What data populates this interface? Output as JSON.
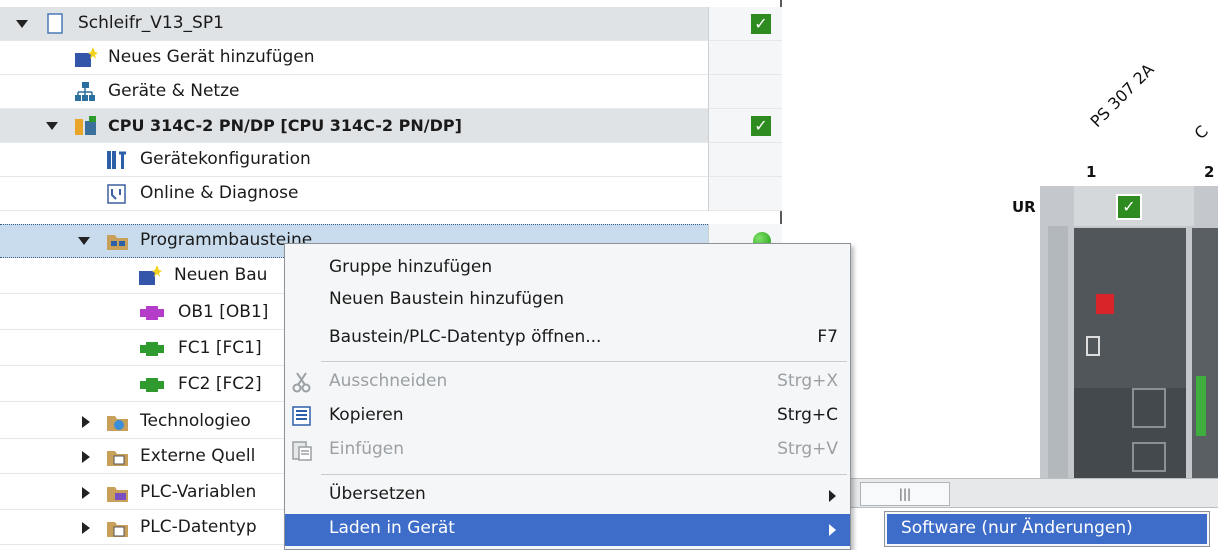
{
  "tree": {
    "rows": [
      {
        "label": "Schleifr_V13_SP1",
        "status": "check"
      },
      {
        "label": "Neues Gerät hinzufügen"
      },
      {
        "label": "Geräte & Netze"
      },
      {
        "label": "CPU 314C-2 PN/DP [CPU 314C-2 PN/DP]",
        "status": "check"
      },
      {
        "label": "Gerätekonfiguration"
      },
      {
        "label": "Online & Diagnose"
      },
      {
        "label": "Programmbausteine",
        "status": "online"
      },
      {
        "label": "Neuen Bau"
      },
      {
        "label": "OB1 [OB1]"
      },
      {
        "label": "FC1 [FC1]"
      },
      {
        "label": "FC2 [FC2]"
      },
      {
        "label": "Technologieo"
      },
      {
        "label": "Externe Quell"
      },
      {
        "label": "PLC-Variablen"
      },
      {
        "label": "PLC-Datentyp"
      }
    ]
  },
  "menu": {
    "items": [
      {
        "label": "Gruppe hinzufügen",
        "shortcut": ""
      },
      {
        "label": "Neuen Baustein hinzufügen",
        "shortcut": ""
      },
      {
        "label": "Baustein/PLC-Datentyp öffnen...",
        "shortcut": "F7"
      },
      {
        "label": "Ausschneiden",
        "shortcut": "Strg+X",
        "disabled": true,
        "icon": "scissors-icon"
      },
      {
        "label": "Kopieren",
        "shortcut": "Strg+C",
        "icon": "copy-icon"
      },
      {
        "label": "Einfügen",
        "shortcut": "Strg+V",
        "disabled": true,
        "icon": "paste-icon"
      },
      {
        "label": "Übersetzen",
        "shortcut": "",
        "submenu": true
      },
      {
        "label": "Laden in Gerät",
        "shortcut": "",
        "submenu": true,
        "highlighted": true
      }
    ]
  },
  "submenu": {
    "items": [
      {
        "label": "Software (nur Änderungen)",
        "highlighted": true
      }
    ]
  },
  "device_view": {
    "module_label": "PS 307 2A",
    "partial_label": "C",
    "rack_label": "UR",
    "slots": [
      "1",
      "2"
    ]
  },
  "colors": {
    "highlight": "#3d6cc9",
    "check_green": "#2e8b1f",
    "selection_row": "#c8dced"
  }
}
